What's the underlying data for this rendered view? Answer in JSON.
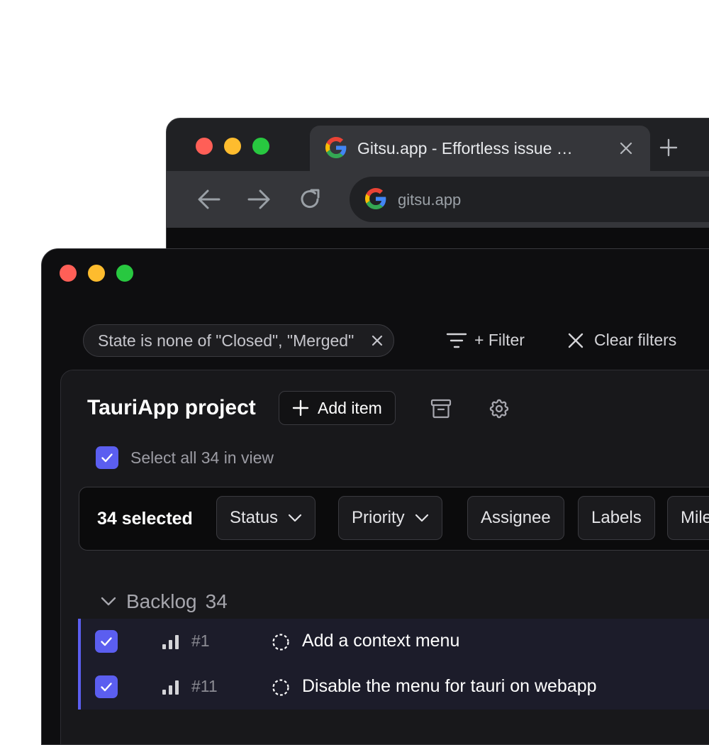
{
  "colors": {
    "traffic_red": "#ff5f57",
    "traffic_yellow": "#febc2e",
    "traffic_green": "#28c840",
    "accent": "#5b5ef0"
  },
  "browser": {
    "tab": {
      "title": "Gitsu.app - Effortless issue …",
      "icon": "google-icon",
      "close_icon": "close-icon"
    },
    "new_tab_icon": "plus-icon",
    "nav": {
      "back_icon": "arrow-left-icon",
      "forward_icon": "arrow-right-icon",
      "reload_icon": "reload-icon"
    },
    "address": {
      "url": "gitsu.app",
      "icon": "google-icon"
    }
  },
  "app": {
    "filters": {
      "chip_text": "State is none of \"Closed\", \"Merged\"",
      "add_filter_label": "+ Filter",
      "clear_filters_label": "Clear filters"
    },
    "project": {
      "title": "TauriApp project",
      "add_item_label": "Add item",
      "archive_icon": "archive-icon",
      "settings_icon": "gear-icon"
    },
    "select_all_label": "Select all 34 in view",
    "bulk_bar": {
      "selected_label": "34 selected",
      "actions": [
        {
          "label": "Status",
          "dropdown": true
        },
        {
          "label": "Priority",
          "dropdown": true
        },
        {
          "label": "Assignee",
          "dropdown": false
        },
        {
          "label": "Labels",
          "dropdown": false
        },
        {
          "label": "Mile",
          "dropdown": false
        }
      ]
    },
    "group": {
      "name": "Backlog",
      "count": "34"
    },
    "items": [
      {
        "number": "#1",
        "title": "Add a context menu",
        "checked": true
      },
      {
        "number": "#11",
        "title": "Disable the menu for tauri on webapp",
        "checked": true
      }
    ]
  }
}
